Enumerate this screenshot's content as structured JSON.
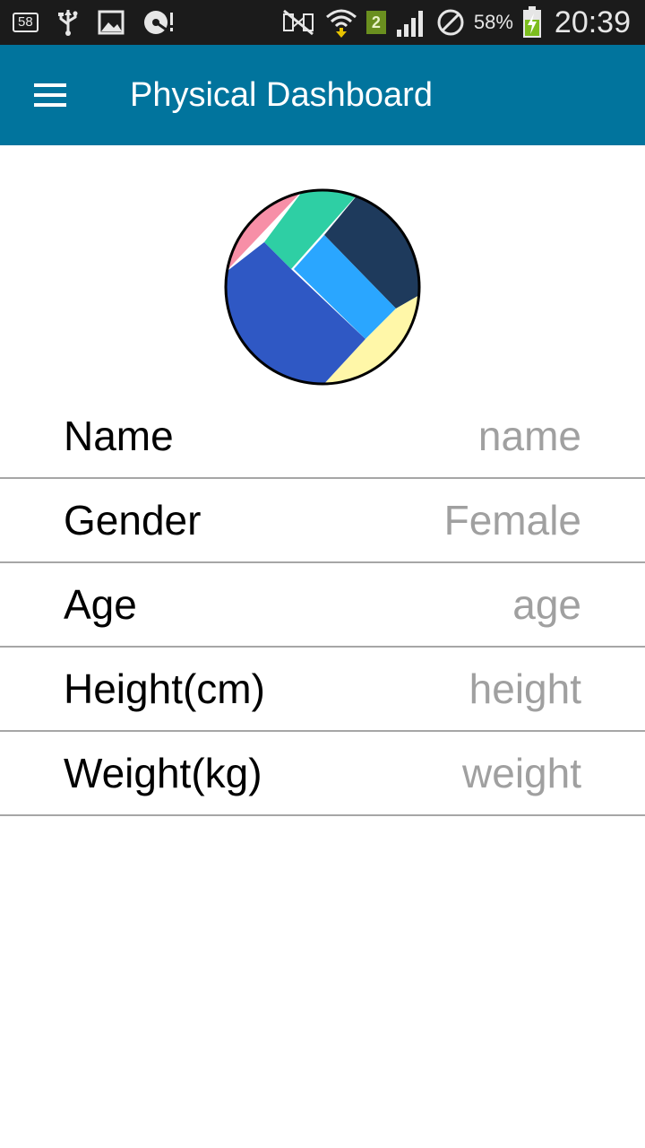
{
  "status_bar": {
    "notification_count": "58",
    "icons": [
      "usb-icon",
      "image-icon",
      "media-icon",
      "nfc-off-icon",
      "wifi-icon",
      "sim-icon",
      "cell-signal-icon",
      "blocked-icon",
      "battery-charging-icon"
    ],
    "sim_slot": "2",
    "battery_percent": "58%",
    "time": "20:39"
  },
  "app_bar": {
    "title": "Physical Dashboard",
    "color": "#01749d"
  },
  "avatar": {
    "colors": [
      "#f78fa7",
      "#2ecfa4",
      "#1e3a5c",
      "#2aa6ff",
      "#2f58c4",
      "#fff7a8"
    ]
  },
  "form": {
    "rows": [
      {
        "label": "Name",
        "value": "name"
      },
      {
        "label": "Gender",
        "value": "Female"
      },
      {
        "label": "Age",
        "value": "age"
      },
      {
        "label": "Height(cm)",
        "value": "height"
      },
      {
        "label": "Weight(kg)",
        "value": "weight"
      }
    ]
  }
}
